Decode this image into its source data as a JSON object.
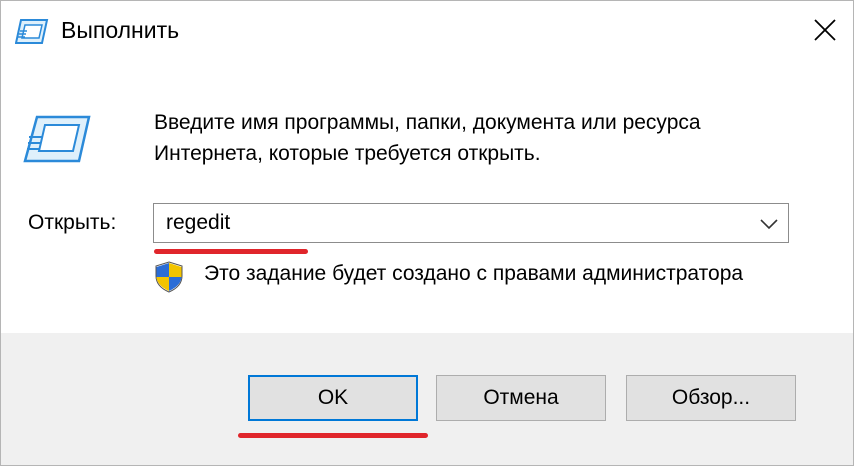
{
  "window": {
    "title": "Выполнить",
    "close_symbol": "✕"
  },
  "content": {
    "icon": "run-app-icon",
    "description_line1": "Введите имя программы, папки, документа или ресурса",
    "description_line2": "Интернета, которые требуется открыть.",
    "open_label": "Открыть:",
    "open_value": "regedit",
    "admin_icon": "uac-shield-icon",
    "admin_text": "Это задание будет создано с правами администратора"
  },
  "buttons": {
    "ok": "OK",
    "cancel": "Отмена",
    "browse": "Обзор..."
  },
  "colors": {
    "accent": "#0078d7",
    "annotation": "#e0252b",
    "footer_bg": "#f0f0f0"
  }
}
